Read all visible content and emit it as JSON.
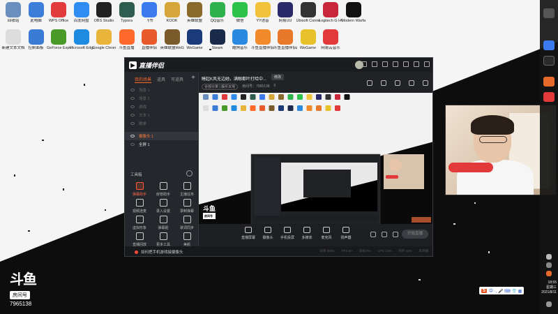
{
  "desktop": {
    "row1": [
      {
        "label": "回收站",
        "icon": "recycle-bin-icon",
        "color": "#6a8fbf"
      },
      {
        "label": "此电脑",
        "icon": "computer-icon",
        "color": "#3d7fd8"
      },
      {
        "label": "WPS Office",
        "icon": "wps-icon",
        "color": "#e23b3b"
      },
      {
        "label": "百度网盘",
        "icon": "cloud-icon",
        "color": "#2f8cf0"
      },
      {
        "label": "OBS Studio",
        "icon": "obs-icon",
        "color": "#222222"
      },
      {
        "label": "Typora",
        "icon": "app-icon",
        "color": "#2e5d4f"
      },
      {
        "label": "飞书",
        "icon": "feishu-icon",
        "color": "#3b7bef"
      },
      {
        "label": "KOOK",
        "icon": "game-icon",
        "color": "#d6a63a"
      },
      {
        "label": "英雄联盟",
        "icon": "game-icon",
        "color": "#8a6a2a"
      },
      {
        "label": "QQ音乐",
        "icon": "music-icon",
        "color": "#2fb24d"
      },
      {
        "label": "微信",
        "icon": "wechat-icon",
        "color": "#2fc24a"
      },
      {
        "label": "YY语音",
        "icon": "yy-icon",
        "color": "#f2c23a"
      },
      {
        "label": "网易UU",
        "icon": "app-icon",
        "color": "#2a2a6a"
      },
      {
        "label": "Ubisoft Connect",
        "icon": "game-icon",
        "color": "#333333"
      },
      {
        "label": "Logitech G HUB",
        "icon": "app-icon",
        "color": "#c8283a"
      },
      {
        "label": "Modern Warfare",
        "icon": "game-icon",
        "color": "#111111"
      }
    ],
    "row2": [
      {
        "label": "新建文本文档",
        "icon": "document-icon",
        "color": "#dddddd"
      },
      {
        "label": "控制面板",
        "icon": "control-panel-icon",
        "color": "#3a7bd5"
      },
      {
        "label": "GeForce Experience",
        "icon": "nvidia-icon",
        "color": "#4a9a2a"
      },
      {
        "label": "Microsoft Edge",
        "icon": "edge-icon",
        "color": "#1f8be0"
      },
      {
        "label": "Google Chrome",
        "icon": "chrome-icon",
        "color": "#e8b53a"
      },
      {
        "label": "斗鱼直播",
        "icon": "game-icon",
        "color": "#ff6a2c"
      },
      {
        "label": "直播伴侣",
        "icon": "game-icon",
        "color": "#e85a2a"
      },
      {
        "label": "英雄联盟WeGame版",
        "icon": "game-icon",
        "color": "#7a5a2a"
      },
      {
        "label": "WeGame",
        "icon": "wegame-icon",
        "color": "#1a3a7a"
      },
      {
        "label": "Steam",
        "icon": "steam-icon",
        "color": "#1a2a4a"
      },
      {
        "label": "酷狗音乐",
        "icon": "kugou-icon",
        "color": "#2a8ae0"
      },
      {
        "label": "斗鱼直播伴侣",
        "icon": "douyu-icon",
        "color": "#f08a2a"
      },
      {
        "label": "斗鱼直播伴侣(2)",
        "icon": "douyu-icon",
        "color": "#e8782a"
      },
      {
        "label": "WeGame",
        "icon": "wegame-icon",
        "color": "#e8c22a"
      },
      {
        "label": "网易云音乐",
        "icon": "music-icon",
        "color": "#e23a3a"
      }
    ]
  },
  "taskbar": {
    "time": "18:55",
    "weekday": "星期三",
    "date": "2021/8/11"
  },
  "douyu_logo": {
    "mark": "斗鱼",
    "room_label": "房间号",
    "room_id": "7965138"
  },
  "app": {
    "brand": "直播伴侣",
    "left_tabs": [
      "我的场景",
      "道具",
      "可道具"
    ],
    "scenes": [
      {
        "label": "场景 1",
        "state": "dim"
      },
      {
        "label": "场景 2",
        "state": "dim"
      },
      {
        "label": "游戏",
        "state": "dim"
      },
      {
        "label": "文本 1",
        "state": "dim"
      },
      {
        "label": "歌单",
        "state": "dim"
      },
      {
        "label": "摄像头 1",
        "state": "active"
      },
      {
        "label": "全屏 1",
        "state": "bright"
      }
    ],
    "tools_title": "工具箱",
    "tools": [
      {
        "label": "弹幕助手",
        "hot": true
      },
      {
        "label": "房管助手",
        "hot": false
      },
      {
        "label": "主播任务",
        "hot": false
      },
      {
        "label": "视频连麦",
        "hot": false
      },
      {
        "label": "录入设置",
        "hot": false
      },
      {
        "label": "录制弹幕",
        "hot": false
      },
      {
        "label": "虚拟形象",
        "hot": false
      },
      {
        "label": "弹幕姬",
        "hot": false
      },
      {
        "label": "歌词同步",
        "hot": false
      },
      {
        "label": "直播回放",
        "hot": false
      },
      {
        "label": "更多工具",
        "hot": false
      },
      {
        "label": "美颜",
        "hot": false
      }
    ],
    "room": {
      "title": "睡起K风无边她，满眼都叶打哈中...",
      "edit": "修改",
      "category": "全部分类 | 娱乐天地",
      "room_label": "房间号：7965138",
      "fans": "0"
    },
    "bottom": [
      {
        "label": "直播屏幕"
      },
      {
        "label": "摄像头"
      },
      {
        "label": "手机投屏"
      },
      {
        "label": "多媒体"
      },
      {
        "label": "麦克风"
      },
      {
        "label": "扬声器"
      }
    ],
    "start_label": "开始直播",
    "status_tip": "如何把手机游戏接摄像头",
    "stats": [
      "码率 0kb/s",
      "FPS 60",
      "丢帧 0%",
      "CPU 13%",
      "内存 22%",
      "未开播"
    ]
  },
  "preview": {
    "label": "斗鱼",
    "sub": "房间号"
  },
  "ime": {
    "logo": "S",
    "text": "中 ·, 🎤 ⌨ 👕 ▦"
  }
}
